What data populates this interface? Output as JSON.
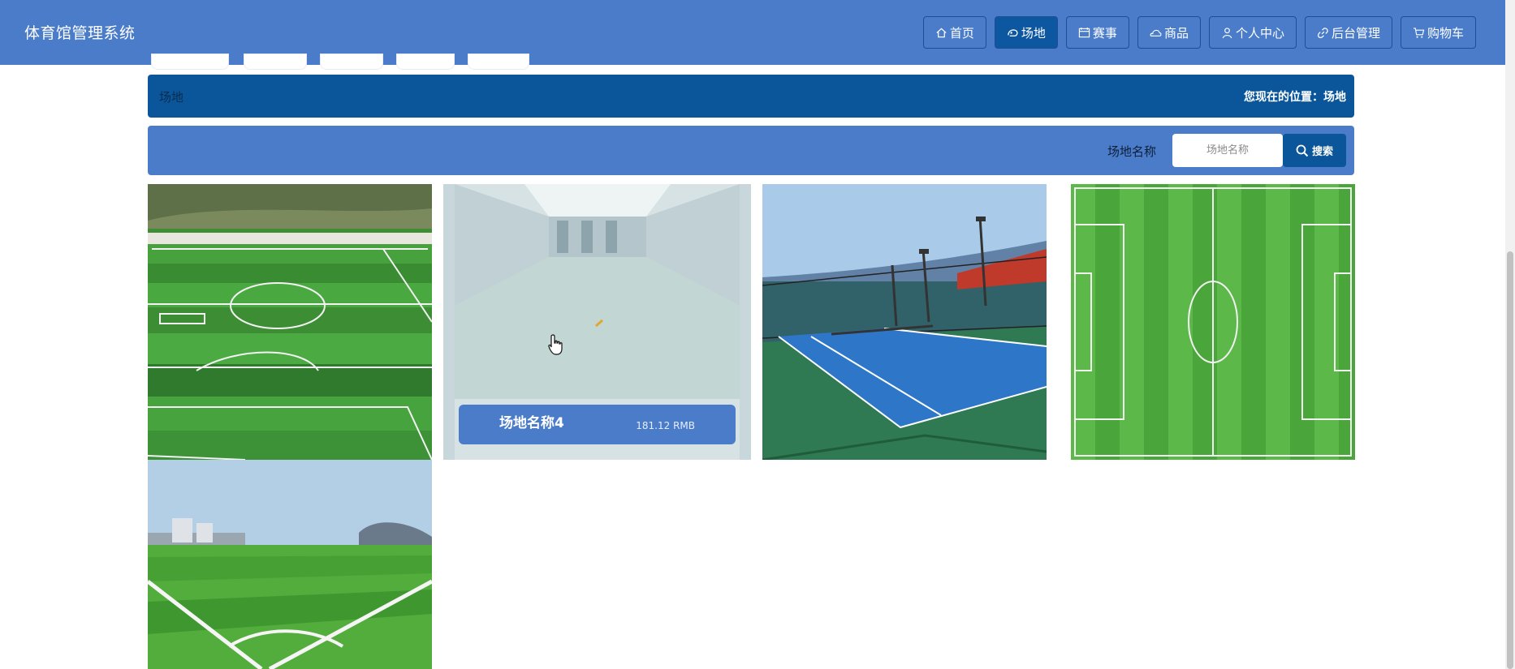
{
  "app": {
    "title": "体育馆管理系统"
  },
  "nav": [
    {
      "label": "首页",
      "icon": "home-icon"
    },
    {
      "label": "场地",
      "icon": "venue-icon",
      "active": true
    },
    {
      "label": "赛事",
      "icon": "calendar-icon"
    },
    {
      "label": "商品",
      "icon": "cloud-icon"
    },
    {
      "label": "个人中心",
      "icon": "user-icon"
    },
    {
      "label": "后台管理",
      "icon": "link-icon"
    },
    {
      "label": "购物车",
      "icon": "cart-icon"
    }
  ],
  "breadcrumb": {
    "title": "场地",
    "location": "您现在的位置：场地"
  },
  "search": {
    "label": "场地名称",
    "placeholder": "场地名称",
    "button": "搜索"
  },
  "venues": [
    {
      "image": "football-field-aerial"
    },
    {
      "image": "indoor-hall",
      "name": "场地名称4",
      "price": "181.12 RMB"
    },
    {
      "image": "tennis-court"
    },
    {
      "image": "football-field-top-down"
    },
    {
      "image": "football-field-ground"
    }
  ],
  "colors": {
    "header": "#4a7cc9",
    "dark": "#0b569b",
    "accent": "#0d57a0"
  }
}
